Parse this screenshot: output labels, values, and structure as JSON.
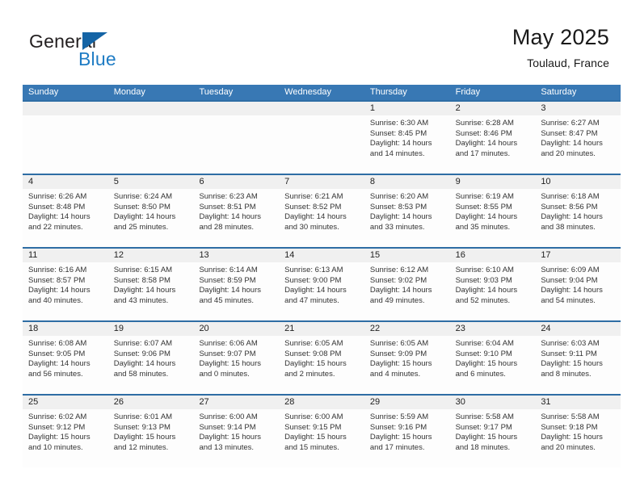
{
  "brand": {
    "name_top": "General",
    "name_bottom": "Blue",
    "accent_color": "#1f7cc4",
    "triangle_color": "#1464a5"
  },
  "header": {
    "title": "May 2025",
    "subtitle": "Toulaud, France",
    "header_bg": "#3878b4",
    "rule_color": "#2e6da4",
    "daynum_bg": "#f0f0f0"
  },
  "weekday_headers": [
    "Sunday",
    "Monday",
    "Tuesday",
    "Wednesday",
    "Thursday",
    "Friday",
    "Saturday"
  ],
  "weeks": [
    {
      "days": [
        {
          "date": "",
          "sunrise": "",
          "sunset": "",
          "daylight_line1": "",
          "daylight_line2": ""
        },
        {
          "date": "",
          "sunrise": "",
          "sunset": "",
          "daylight_line1": "",
          "daylight_line2": ""
        },
        {
          "date": "",
          "sunrise": "",
          "sunset": "",
          "daylight_line1": "",
          "daylight_line2": ""
        },
        {
          "date": "",
          "sunrise": "",
          "sunset": "",
          "daylight_line1": "",
          "daylight_line2": ""
        },
        {
          "date": "1",
          "sunrise": "Sunrise: 6:30 AM",
          "sunset": "Sunset: 8:45 PM",
          "daylight_line1": "Daylight: 14 hours",
          "daylight_line2": "and 14 minutes."
        },
        {
          "date": "2",
          "sunrise": "Sunrise: 6:28 AM",
          "sunset": "Sunset: 8:46 PM",
          "daylight_line1": "Daylight: 14 hours",
          "daylight_line2": "and 17 minutes."
        },
        {
          "date": "3",
          "sunrise": "Sunrise: 6:27 AM",
          "sunset": "Sunset: 8:47 PM",
          "daylight_line1": "Daylight: 14 hours",
          "daylight_line2": "and 20 minutes."
        }
      ]
    },
    {
      "days": [
        {
          "date": "4",
          "sunrise": "Sunrise: 6:26 AM",
          "sunset": "Sunset: 8:48 PM",
          "daylight_line1": "Daylight: 14 hours",
          "daylight_line2": "and 22 minutes."
        },
        {
          "date": "5",
          "sunrise": "Sunrise: 6:24 AM",
          "sunset": "Sunset: 8:50 PM",
          "daylight_line1": "Daylight: 14 hours",
          "daylight_line2": "and 25 minutes."
        },
        {
          "date": "6",
          "sunrise": "Sunrise: 6:23 AM",
          "sunset": "Sunset: 8:51 PM",
          "daylight_line1": "Daylight: 14 hours",
          "daylight_line2": "and 28 minutes."
        },
        {
          "date": "7",
          "sunrise": "Sunrise: 6:21 AM",
          "sunset": "Sunset: 8:52 PM",
          "daylight_line1": "Daylight: 14 hours",
          "daylight_line2": "and 30 minutes."
        },
        {
          "date": "8",
          "sunrise": "Sunrise: 6:20 AM",
          "sunset": "Sunset: 8:53 PM",
          "daylight_line1": "Daylight: 14 hours",
          "daylight_line2": "and 33 minutes."
        },
        {
          "date": "9",
          "sunrise": "Sunrise: 6:19 AM",
          "sunset": "Sunset: 8:55 PM",
          "daylight_line1": "Daylight: 14 hours",
          "daylight_line2": "and 35 minutes."
        },
        {
          "date": "10",
          "sunrise": "Sunrise: 6:18 AM",
          "sunset": "Sunset: 8:56 PM",
          "daylight_line1": "Daylight: 14 hours",
          "daylight_line2": "and 38 minutes."
        }
      ]
    },
    {
      "days": [
        {
          "date": "11",
          "sunrise": "Sunrise: 6:16 AM",
          "sunset": "Sunset: 8:57 PM",
          "daylight_line1": "Daylight: 14 hours",
          "daylight_line2": "and 40 minutes."
        },
        {
          "date": "12",
          "sunrise": "Sunrise: 6:15 AM",
          "sunset": "Sunset: 8:58 PM",
          "daylight_line1": "Daylight: 14 hours",
          "daylight_line2": "and 43 minutes."
        },
        {
          "date": "13",
          "sunrise": "Sunrise: 6:14 AM",
          "sunset": "Sunset: 8:59 PM",
          "daylight_line1": "Daylight: 14 hours",
          "daylight_line2": "and 45 minutes."
        },
        {
          "date": "14",
          "sunrise": "Sunrise: 6:13 AM",
          "sunset": "Sunset: 9:00 PM",
          "daylight_line1": "Daylight: 14 hours",
          "daylight_line2": "and 47 minutes."
        },
        {
          "date": "15",
          "sunrise": "Sunrise: 6:12 AM",
          "sunset": "Sunset: 9:02 PM",
          "daylight_line1": "Daylight: 14 hours",
          "daylight_line2": "and 49 minutes."
        },
        {
          "date": "16",
          "sunrise": "Sunrise: 6:10 AM",
          "sunset": "Sunset: 9:03 PM",
          "daylight_line1": "Daylight: 14 hours",
          "daylight_line2": "and 52 minutes."
        },
        {
          "date": "17",
          "sunrise": "Sunrise: 6:09 AM",
          "sunset": "Sunset: 9:04 PM",
          "daylight_line1": "Daylight: 14 hours",
          "daylight_line2": "and 54 minutes."
        }
      ]
    },
    {
      "days": [
        {
          "date": "18",
          "sunrise": "Sunrise: 6:08 AM",
          "sunset": "Sunset: 9:05 PM",
          "daylight_line1": "Daylight: 14 hours",
          "daylight_line2": "and 56 minutes."
        },
        {
          "date": "19",
          "sunrise": "Sunrise: 6:07 AM",
          "sunset": "Sunset: 9:06 PM",
          "daylight_line1": "Daylight: 14 hours",
          "daylight_line2": "and 58 minutes."
        },
        {
          "date": "20",
          "sunrise": "Sunrise: 6:06 AM",
          "sunset": "Sunset: 9:07 PM",
          "daylight_line1": "Daylight: 15 hours",
          "daylight_line2": "and 0 minutes."
        },
        {
          "date": "21",
          "sunrise": "Sunrise: 6:05 AM",
          "sunset": "Sunset: 9:08 PM",
          "daylight_line1": "Daylight: 15 hours",
          "daylight_line2": "and 2 minutes."
        },
        {
          "date": "22",
          "sunrise": "Sunrise: 6:05 AM",
          "sunset": "Sunset: 9:09 PM",
          "daylight_line1": "Daylight: 15 hours",
          "daylight_line2": "and 4 minutes."
        },
        {
          "date": "23",
          "sunrise": "Sunrise: 6:04 AM",
          "sunset": "Sunset: 9:10 PM",
          "daylight_line1": "Daylight: 15 hours",
          "daylight_line2": "and 6 minutes."
        },
        {
          "date": "24",
          "sunrise": "Sunrise: 6:03 AM",
          "sunset": "Sunset: 9:11 PM",
          "daylight_line1": "Daylight: 15 hours",
          "daylight_line2": "and 8 minutes."
        }
      ]
    },
    {
      "days": [
        {
          "date": "25",
          "sunrise": "Sunrise: 6:02 AM",
          "sunset": "Sunset: 9:12 PM",
          "daylight_line1": "Daylight: 15 hours",
          "daylight_line2": "and 10 minutes."
        },
        {
          "date": "26",
          "sunrise": "Sunrise: 6:01 AM",
          "sunset": "Sunset: 9:13 PM",
          "daylight_line1": "Daylight: 15 hours",
          "daylight_line2": "and 12 minutes."
        },
        {
          "date": "27",
          "sunrise": "Sunrise: 6:00 AM",
          "sunset": "Sunset: 9:14 PM",
          "daylight_line1": "Daylight: 15 hours",
          "daylight_line2": "and 13 minutes."
        },
        {
          "date": "28",
          "sunrise": "Sunrise: 6:00 AM",
          "sunset": "Sunset: 9:15 PM",
          "daylight_line1": "Daylight: 15 hours",
          "daylight_line2": "and 15 minutes."
        },
        {
          "date": "29",
          "sunrise": "Sunrise: 5:59 AM",
          "sunset": "Sunset: 9:16 PM",
          "daylight_line1": "Daylight: 15 hours",
          "daylight_line2": "and 17 minutes."
        },
        {
          "date": "30",
          "sunrise": "Sunrise: 5:58 AM",
          "sunset": "Sunset: 9:17 PM",
          "daylight_line1": "Daylight: 15 hours",
          "daylight_line2": "and 18 minutes."
        },
        {
          "date": "31",
          "sunrise": "Sunrise: 5:58 AM",
          "sunset": "Sunset: 9:18 PM",
          "daylight_line1": "Daylight: 15 hours",
          "daylight_line2": "and 20 minutes."
        }
      ]
    }
  ]
}
